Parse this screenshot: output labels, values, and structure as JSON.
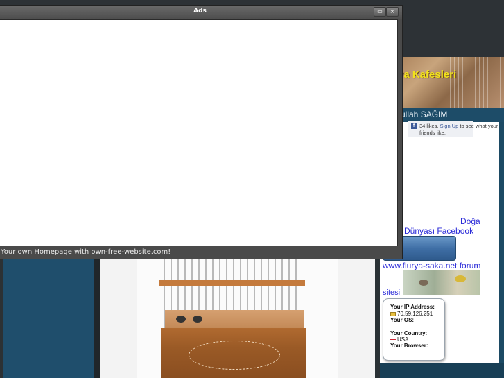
{
  "ads_window": {
    "title": "Ads",
    "minimize_label": "▭",
    "close_label": "×",
    "footer_link": "Your own Homepage with own-free-website.com!"
  },
  "site": {
    "header_title": "ya Kafesleri",
    "owner_name": "ullah SAĞIM",
    "facebook": {
      "likes_prefix": "34 likes.",
      "signup": "Sign Up",
      "likes_suffix": "to see what your friends like.",
      "icon": "f"
    },
    "links": {
      "doga": "Doğa",
      "facebook_line": "n Dünyası Facebook",
      "forum_line": "www.flurya-saka.net forum",
      "sitesi": "sitesi"
    },
    "ip_box": {
      "ip_label": "Your IP Address:",
      "ip_value": "70.59.126.251",
      "os_label": "Your OS:",
      "country_label": "Your Country:",
      "country_value": "USA",
      "browser_label": "Your Browser:"
    }
  },
  "colors": {
    "accent_yellow": "#f2e21a",
    "link_blue": "#2a2ad8",
    "panel_blue": "#1f4e6c"
  }
}
